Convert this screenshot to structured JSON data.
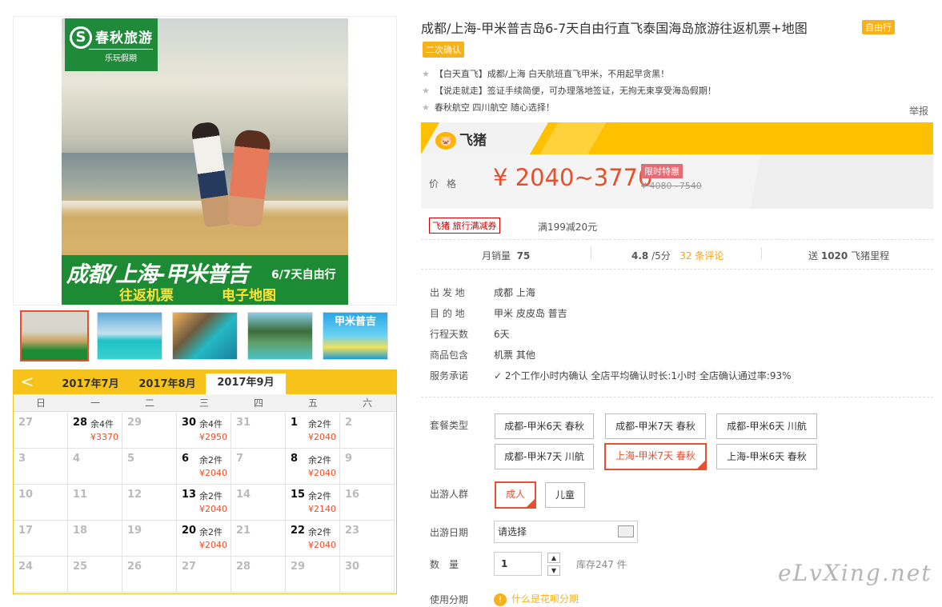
{
  "product": {
    "title": "成都/上海-甲米普吉岛6-7天自由行直飞泰国海岛旅游往返机票+地图",
    "tag_free": "自由行",
    "tag_confirm": "二次确认",
    "features": [
      "【白天直飞】成都/上海 白天航班直飞甲米，不用起早贪黑！",
      "【说走就走】签证手续简便，可办理落地签证，无拘无束享受海岛假期！",
      "春秋航空 四川航空 随心选择！"
    ],
    "report_label": "举报"
  },
  "gallery": {
    "logo_name": "春秋旅游",
    "logo_slogan": "乐玩假期",
    "banner_main": "成都/上海-甲米普吉",
    "banner_sub": "6/7天自由行",
    "banner_line2a": "往返机票",
    "banner_line2b": "电子地图",
    "thumbs": [
      "main-photo",
      "beach-swim",
      "cove",
      "island",
      "jiami-puji-promo"
    ],
    "thumb4_text": "甲米普吉"
  },
  "calendar": {
    "prev": "<",
    "months": [
      "2017年7月",
      "2017年8月",
      "2017年9月"
    ],
    "selected_month": "2017年9月",
    "weekdays": [
      "日",
      "一",
      "二",
      "三",
      "四",
      "五",
      "六"
    ],
    "rows": [
      [
        {
          "d": "27"
        },
        {
          "d": "28",
          "s": "余4件",
          "p": "¥3370"
        },
        {
          "d": "29"
        },
        {
          "d": "30",
          "s": "余4件",
          "p": "¥2950"
        },
        {
          "d": "31"
        },
        {
          "d": "1",
          "s": "余2件",
          "p": "¥2040"
        },
        {
          "d": "2"
        }
      ],
      [
        {
          "d": "3"
        },
        {
          "d": "4"
        },
        {
          "d": "5"
        },
        {
          "d": "6",
          "s": "余2件",
          "p": "¥2040"
        },
        {
          "d": "7"
        },
        {
          "d": "8",
          "s": "余2件",
          "p": "¥2040"
        },
        {
          "d": "9"
        }
      ],
      [
        {
          "d": "10"
        },
        {
          "d": "11"
        },
        {
          "d": "12"
        },
        {
          "d": "13",
          "s": "余2件",
          "p": "¥2040"
        },
        {
          "d": "14"
        },
        {
          "d": "15",
          "s": "余2件",
          "p": "¥2140"
        },
        {
          "d": "16"
        }
      ],
      [
        {
          "d": "17"
        },
        {
          "d": "18"
        },
        {
          "d": "19"
        },
        {
          "d": "20",
          "s": "余2件",
          "p": "¥2040"
        },
        {
          "d": "21"
        },
        {
          "d": "22",
          "s": "余2件",
          "p": "¥2040"
        },
        {
          "d": "23"
        }
      ],
      [
        {
          "d": "24"
        },
        {
          "d": "25"
        },
        {
          "d": "26"
        },
        {
          "d": "27"
        },
        {
          "d": "28"
        },
        {
          "d": "29"
        },
        {
          "d": "30"
        }
      ]
    ]
  },
  "fliggy": {
    "brand": "飞猪",
    "pig": "🐷"
  },
  "price": {
    "label": "价格",
    "range": "¥ 2040~3770",
    "badge": "限时特惠",
    "original": "¥ 4080~7540"
  },
  "coupon": {
    "label": "飞猪 旅行满减券",
    "desc": "满199减20元"
  },
  "stats": {
    "monthly_label": "月销量",
    "monthly_value": "75",
    "rating_value": "4.8",
    "rating_unit": "/5分",
    "reviews": "32 条评论",
    "miles_prefix": "送",
    "miles_value": "1020",
    "miles_suffix": "飞猪里程"
  },
  "info": [
    {
      "label": "出 发 地",
      "value": "成都   上海"
    },
    {
      "label": "目 的 地",
      "value": "甲米   皮皮岛   普吉"
    },
    {
      "label": "行程天数",
      "value": "6天"
    },
    {
      "label": "商品包含",
      "value": "机票   其他"
    },
    {
      "label": "服务承诺",
      "value": "2个工作小时内确认     全店平均确认时长:1小时     全店确认通过率:93%"
    }
  ],
  "options": {
    "package_label": "套餐类型",
    "packages": [
      "成都-甲米6天 春秋",
      "成都-甲米7天 春秋",
      "成都-甲米6天 川航",
      "成都-甲米7天 川航",
      "上海-甲米7天 春秋",
      "上海-甲米6天 春秋"
    ],
    "people_label": "出游人群",
    "people": [
      "成人",
      "儿童"
    ],
    "date_label": "出游日期",
    "date_placeholder": "请选择",
    "qty_label": "数　量",
    "qty_value": "1",
    "up": "▲",
    "down": "▼",
    "stock": "库存247 件",
    "instal_label": "使用分期",
    "instal_icon": "!",
    "instal_link": "什么是花呗分期"
  },
  "watermark": "eLvXing.net"
}
